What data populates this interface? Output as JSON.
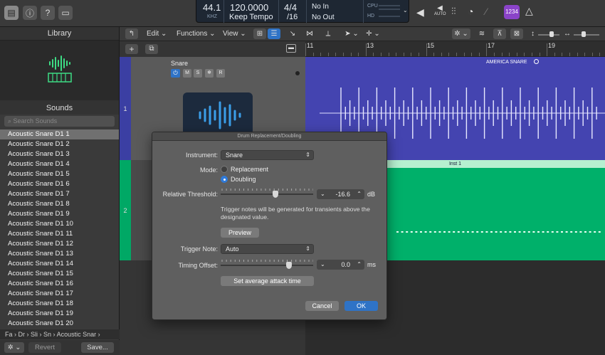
{
  "control_bar": {
    "tempo_sample_rate": "44.1",
    "sample_rate_unit": "KHZ",
    "tempo": "120.0000",
    "tempo_mode": "Keep Tempo",
    "time_sig": "4/4",
    "division": "/16",
    "in": "No In",
    "out": "No Out",
    "cpu_label": "CPU",
    "hd_label": "HD",
    "auto_label": "AUTO",
    "counter_label": "1234"
  },
  "library": {
    "title": "Library",
    "sounds_title": "Sounds",
    "search_placeholder": "Search Sounds",
    "items": [
      "Acoustic Snare D1 1",
      "Acoustic Snare D1 2",
      "Acoustic Snare D1 3",
      "Acoustic Snare D1 4",
      "Acoustic Snare D1 5",
      "Acoustic Snare D1 6",
      "Acoustic Snare D1 7",
      "Acoustic Snare D1 8",
      "Acoustic Snare D1 9",
      "Acoustic Snare D1 10",
      "Acoustic Snare D1 11",
      "Acoustic Snare D1 12",
      "Acoustic Snare D1 13",
      "Acoustic Snare D1 14",
      "Acoustic Snare D1 15",
      "Acoustic Snare D1 16",
      "Acoustic Snare D1 17",
      "Acoustic Snare D1 18",
      "Acoustic Snare D1 19",
      "Acoustic Snare D1 20"
    ],
    "selected_index": 0,
    "breadcrumb": [
      "Fa",
      "Dr",
      "Sli",
      "Sn",
      "Acoustic Snar"
    ],
    "revert_label": "Revert",
    "save_label": "Save..."
  },
  "toolbar": {
    "edit": "Edit",
    "functions": "Functions",
    "view": "View"
  },
  "ruler": {
    "marks": [
      "11",
      "13",
      "15",
      "17",
      "19"
    ]
  },
  "tracks": [
    {
      "number": "1",
      "name": "Snare",
      "region_name": "AMERICA SNARE",
      "mute": "M",
      "solo": "S",
      "freeze": "❄",
      "record": "R"
    },
    {
      "number": "2",
      "name": "",
      "region_name": "Inst 1"
    }
  ],
  "dialog": {
    "title": "Drum Replacement/Doubling",
    "instrument_label": "Instrument:",
    "instrument_value": "Snare",
    "mode_label": "Mode:",
    "mode_replacement": "Replacement",
    "mode_doubling": "Doubling",
    "mode_selected": "Doubling",
    "threshold_label": "Relative Threshold:",
    "threshold_value": "-16.6",
    "threshold_unit": "dB",
    "threshold_fraction": 0.59,
    "hint": "Trigger notes will be generated for transients above the designated value.",
    "preview_label": "Preview",
    "trigger_note_label": "Trigger Note:",
    "trigger_note_value": "Auto",
    "timing_offset_label": "Timing Offset:",
    "timing_offset_value": "0.0",
    "timing_offset_unit": "ms",
    "timing_offset_fraction": 0.74,
    "set_attack_label": "Set average attack time",
    "cancel_label": "Cancel",
    "ok_label": "OK"
  },
  "colors": {
    "track1": "#4444b0",
    "track2": "#00b06a",
    "accent": "#2f73c6"
  }
}
